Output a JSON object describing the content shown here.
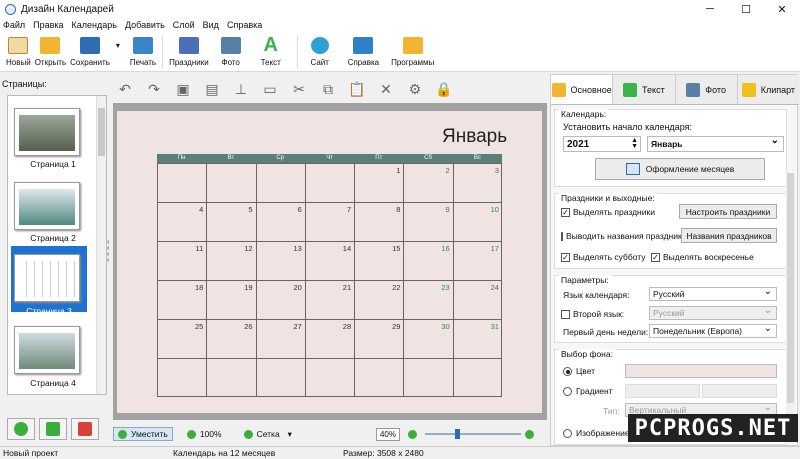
{
  "window": {
    "title": "Дизайн Календарей"
  },
  "menu": [
    "Файл",
    "Правка",
    "Календарь",
    "Добавить",
    "Слой",
    "Вид",
    "Справка"
  ],
  "toolbar": [
    {
      "label": "Новый",
      "icon": "new-document-icon",
      "color": "#f2d9a0"
    },
    {
      "label": "Открыть",
      "icon": "folder-open-icon",
      "color": "#f2b531"
    },
    {
      "label": "Сохранить",
      "icon": "save-disk-icon",
      "color": "#2e6db3"
    },
    {
      "label": "Печать",
      "icon": "printer-icon",
      "color": "#3a85c9"
    },
    {
      "label": "Праздники",
      "icon": "calendar-holidays-icon",
      "color": "#4a70b6"
    },
    {
      "label": "Фото",
      "icon": "camera-icon",
      "color": "#5a7fa6"
    },
    {
      "label": "Текст",
      "icon": "text-a-icon",
      "color": "#3bb34a"
    },
    {
      "label": "Сайт",
      "icon": "globe-icon",
      "color": "#2f9fd8"
    },
    {
      "label": "Справка",
      "icon": "help-book-icon",
      "color": "#2f7fc9"
    },
    {
      "label": "Программы",
      "icon": "tshirt-programs-icon",
      "color": "#f2b531"
    }
  ],
  "pages": {
    "header": "Страницы:",
    "items": [
      "Страница 1",
      "Страница 2",
      "Страница 3",
      "Страница 4"
    ]
  },
  "calendar": {
    "month": "Январь",
    "days": [
      "Пн",
      "Вт",
      "Ср",
      "Чт",
      "Пт",
      "Сб",
      "Вс"
    ],
    "weeks": [
      [
        "",
        "",
        "",
        "",
        "1",
        "2",
        "3"
      ],
      [
        "4",
        "5",
        "6",
        "7",
        "8",
        "9",
        "10"
      ],
      [
        "11",
        "12",
        "13",
        "14",
        "15",
        "16",
        "17"
      ],
      [
        "18",
        "19",
        "20",
        "21",
        "22",
        "23",
        "24"
      ],
      [
        "25",
        "26",
        "27",
        "28",
        "29",
        "30",
        "31"
      ],
      [
        "",
        "",
        "",
        "",
        "",
        "",
        ""
      ]
    ]
  },
  "canvas_status": {
    "fit": "Уместить",
    "zoom100": "100%",
    "grid": "Сетка",
    "zoom": "40%"
  },
  "tabs": [
    "Основное",
    "Текст",
    "Фото",
    "Клипарт"
  ],
  "calendar_group": {
    "title": "Календарь:",
    "start_label": "Установить начало календаря:",
    "year": "2021",
    "month": "Январь",
    "design_button": "Оформление месяцев"
  },
  "holidays_group": {
    "title": "Праздники и выходные:",
    "highlight_holidays": "Выделять праздники",
    "setup_holidays": "Настроить праздники",
    "show_names": "Выводить названия праздников",
    "holiday_names": "Названия праздников",
    "highlight_saturday": "Выделять субботу",
    "highlight_sunday": "Выделять воскресенье"
  },
  "params_group": {
    "title": "Параметры:",
    "lang_label": "Язык календаря:",
    "lang_value": "Русский",
    "second_lang": "Второй язык:",
    "second_value": "Русский",
    "first_day_label": "Первый день недели:",
    "first_day_value": "Понедельник (Европа)"
  },
  "bg_group": {
    "title": "Выбор фона:",
    "color": "Цвет",
    "gradient": "Градиент",
    "type_label": "Тип:",
    "type_value": "Вертикальный",
    "image": "Изображение",
    "bg_color": "#efe4e2"
  },
  "status": {
    "project": "Новый проект",
    "info": "Календарь на 12 месяцев",
    "size": "Размер: 3508 x 2480"
  },
  "watermark": "PCPROGS.NET"
}
